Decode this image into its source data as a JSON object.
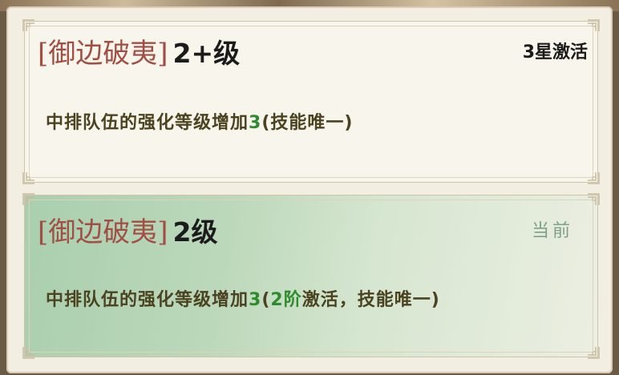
{
  "colors": {
    "title_red": "#a14f45",
    "value_green": "#2e8b2e",
    "desc_olive": "#4b4320",
    "current_label_green": "#7ea08b",
    "active_card_bg": "#b7d6b8"
  },
  "cards": [
    {
      "bracket_open": "[",
      "name": "御边破夷",
      "bracket_close": "]",
      "level": "2+级",
      "status": "3星激活",
      "desc_prefix": "中排队伍的强化等级增加",
      "desc_value": "3",
      "desc_mid": "",
      "desc_suffix": "(技能唯一)"
    },
    {
      "bracket_open": "[",
      "name": "御边破夷",
      "bracket_close": "]",
      "level": "2级",
      "status": "当前",
      "desc_prefix": "中排队伍的强化等级增加",
      "desc_value": "3",
      "desc_mid_open": "(",
      "desc_mid": "2阶",
      "desc_suffix": "激活，技能唯一)"
    }
  ]
}
